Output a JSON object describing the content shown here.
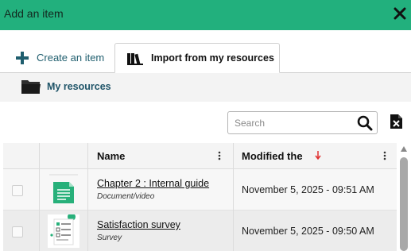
{
  "dialog": {
    "title": "Add an item",
    "close_icon": "close-icon"
  },
  "tabs": [
    {
      "label": "Create an item",
      "icon": "plus-icon",
      "active": false
    },
    {
      "label": "Import from my resources",
      "icon": "books-icon",
      "active": true
    }
  ],
  "breadcrumb": {
    "label": "My resources",
    "icon": "folder-icon"
  },
  "search": {
    "placeholder": "Search",
    "value": ""
  },
  "table": {
    "columns": {
      "name": "Name",
      "modified": "Modified the",
      "sort": "descending"
    },
    "rows": [
      {
        "name": "Chapter 2 : Internal guide",
        "type": "Document/video",
        "modified": "November 5, 2025 - 09:51 AM",
        "thumb": "document-thumbnail"
      },
      {
        "name": "Satisfaction survey",
        "type": "Survey",
        "modified": "November 5, 2025 - 09:50 AM",
        "thumb": "survey-thumbnail"
      }
    ]
  },
  "colors": {
    "header": "#22b07d",
    "accent_text": "#1f5e6e",
    "sort_arrow": "#e03030",
    "doc_green": "#27b07a"
  }
}
